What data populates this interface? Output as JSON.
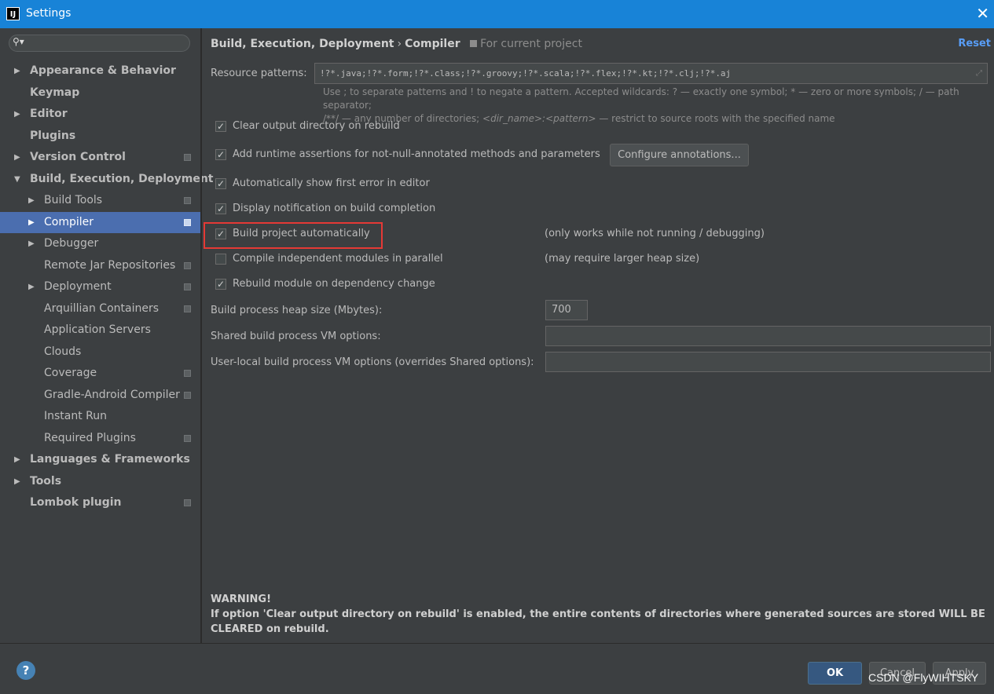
{
  "window": {
    "title": "Settings",
    "app_icon_text": "IJ",
    "close_glyph": "✕"
  },
  "search": {
    "placeholder": "",
    "icon": "search-icon"
  },
  "tree": [
    {
      "label": "Appearance & Behavior",
      "bold": true,
      "arrow": "▶",
      "proj": false
    },
    {
      "label": "Keymap",
      "bold": true,
      "arrow": "",
      "proj": false
    },
    {
      "label": "Editor",
      "bold": true,
      "arrow": "▶",
      "proj": false
    },
    {
      "label": "Plugins",
      "bold": true,
      "arrow": "",
      "proj": false
    },
    {
      "label": "Version Control",
      "bold": true,
      "arrow": "▶",
      "proj": true
    },
    {
      "label": "Build, Execution, Deployment",
      "bold": true,
      "arrow": "▼",
      "proj": false
    },
    {
      "label": "Build Tools",
      "bold": false,
      "arrow": "▶",
      "proj": true
    },
    {
      "label": "Compiler",
      "bold": false,
      "arrow": "▶",
      "proj": true,
      "selected": true
    },
    {
      "label": "Debugger",
      "bold": false,
      "arrow": "▶",
      "proj": false
    },
    {
      "label": "Remote Jar Repositories",
      "bold": false,
      "arrow": "",
      "proj": true
    },
    {
      "label": "Deployment",
      "bold": false,
      "arrow": "▶",
      "proj": true
    },
    {
      "label": "Arquillian Containers",
      "bold": false,
      "arrow": "",
      "proj": true
    },
    {
      "label": "Application Servers",
      "bold": false,
      "arrow": "",
      "proj": false
    },
    {
      "label": "Clouds",
      "bold": false,
      "arrow": "",
      "proj": false
    },
    {
      "label": "Coverage",
      "bold": false,
      "arrow": "",
      "proj": true
    },
    {
      "label": "Gradle-Android Compiler",
      "bold": false,
      "arrow": "",
      "proj": true
    },
    {
      "label": "Instant Run",
      "bold": false,
      "arrow": "",
      "proj": false
    },
    {
      "label": "Required Plugins",
      "bold": false,
      "arrow": "",
      "proj": true
    },
    {
      "label": "Languages & Frameworks",
      "bold": true,
      "arrow": "▶",
      "proj": false
    },
    {
      "label": "Tools",
      "bold": true,
      "arrow": "▶",
      "proj": false
    },
    {
      "label": "Lombok plugin",
      "bold": true,
      "arrow": "",
      "proj": true
    }
  ],
  "header": {
    "crumb_parent": "Build, Execution, Deployment",
    "crumb_sep": "›",
    "crumb_current": "Compiler",
    "scope": "For current project",
    "reset": "Reset"
  },
  "resource": {
    "label": "Resource patterns:",
    "value": "!?*.java;!?*.form;!?*.class;!?*.groovy;!?*.scala;!?*.flex;!?*.kt;!?*.clj;!?*.aj",
    "hint_line1": "Use ; to separate patterns and ! to negate a pattern. Accepted wildcards: ? — exactly one symbol; * — zero or more symbols; / — path separator;",
    "hint_line2_a": "/**/ — any number of directories; ",
    "hint_line2_b": "<dir_name>:<pattern>",
    "hint_line2_c": " — restrict to source roots with the specified name"
  },
  "options": {
    "clear_output": {
      "label": "Clear output directory on rebuild",
      "checked": true
    },
    "runtime_assertions": {
      "label": "Add runtime assertions for not-null-annotated methods and parameters",
      "checked": true
    },
    "configure_annotations": "Configure annotations...",
    "show_first_error": {
      "label": "Automatically show first error in editor",
      "checked": true
    },
    "notify_completion": {
      "label": "Display notification on build completion",
      "checked": true
    },
    "build_auto": {
      "label": "Build project automatically",
      "checked": true,
      "note": "(only works while not running / debugging)"
    },
    "parallel": {
      "label": "Compile independent modules in parallel",
      "checked": false,
      "note": "(may require larger heap size)"
    },
    "rebuild_dep": {
      "label": "Rebuild module on dependency change",
      "checked": true
    }
  },
  "heap": {
    "label": "Build process heap size (Mbytes):",
    "value": "700"
  },
  "shared_vm": {
    "label": "Shared build process VM options:",
    "value": ""
  },
  "user_vm": {
    "label": "User-local build process VM options (overrides Shared options):",
    "value": ""
  },
  "warning": {
    "title": "WARNING!",
    "text": "If option 'Clear output directory on rebuild' is enabled, the entire contents of directories where generated sources are stored WILL BE CLEARED on rebuild."
  },
  "footer": {
    "help": "?",
    "ok": "OK",
    "cancel": "Cancel",
    "apply": "Apply"
  },
  "watermark": "CSDN @FlyWIHTSKY"
}
